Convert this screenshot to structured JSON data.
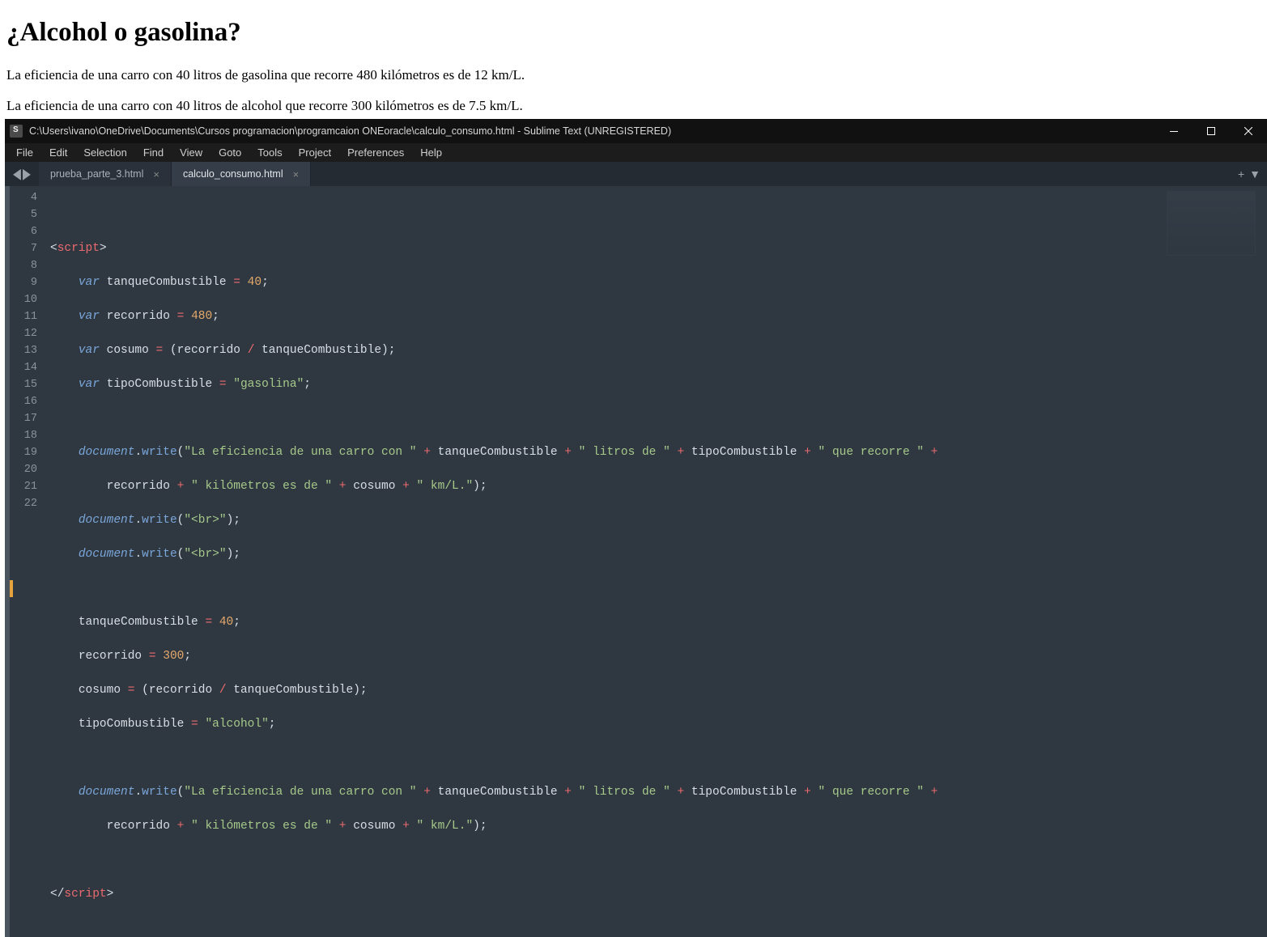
{
  "browser": {
    "heading": "¿Alcohol o gasolina?",
    "line1": "La eficiencia de una carro con 40 litros de gasolina que recorre 480 kilómetros es de 12 km/L.",
    "line2": "La eficiencia de una carro con 40 litros de alcohol que recorre 300 kilómetros es de 7.5 km/L."
  },
  "sublime": {
    "title": "C:\\Users\\ivano\\OneDrive\\Documents\\Cursos programacion\\programcaion ONEoracle\\calculo_consumo.html - Sublime Text (UNREGISTERED)",
    "menu": [
      "File",
      "Edit",
      "Selection",
      "Find",
      "View",
      "Goto",
      "Tools",
      "Project",
      "Preferences",
      "Help"
    ],
    "tabs": {
      "left_nav_back": "◀",
      "left_nav_fwd": "▶",
      "items": [
        {
          "label": "prueba_parte_3.html",
          "close": "×"
        },
        {
          "label": "calculo_consumo.html",
          "close": "×"
        }
      ],
      "new_tab": "+",
      "dropdown": "▼"
    },
    "gutter": [
      "4",
      "5",
      "6",
      "7",
      "8",
      "9",
      "10",
      "11",
      "",
      "12",
      "13",
      "14",
      "15",
      "16",
      "17",
      "18",
      "19",
      "20",
      "",
      "21",
      "22"
    ],
    "code": {
      "l5_open": "<",
      "l5_tag": "script",
      "l5_close": ">",
      "kw_var": "var",
      "v_tanque": "tanqueCombustible",
      "eq": "=",
      "n40": "40",
      "semi": ";",
      "v_recorrido": "recorrido",
      "n480": "480",
      "v_cosumo": "cosumo",
      "lp": "(",
      "rp": ")",
      "slash": "/",
      "v_tipo": "tipoCombustible",
      "s_gasolina": "\"gasolina\"",
      "obj_document": "document",
      "dot": ".",
      "m_write": "write",
      "s_efi": "\"La eficiencia de una carro con \"",
      "plus": "+",
      "s_litros": "\" litros de \"",
      "s_recorre": "\" que recorre \"",
      "s_kmes": "\" kilómetros es de \"",
      "s_kmL": "\" km/L.\"",
      "s_br": "\"<br>\"",
      "n300": "300",
      "s_alcohol": "\"alcohol\"",
      "l22_open": "</",
      "l22_tag": "script",
      "l22_close": ">"
    }
  }
}
